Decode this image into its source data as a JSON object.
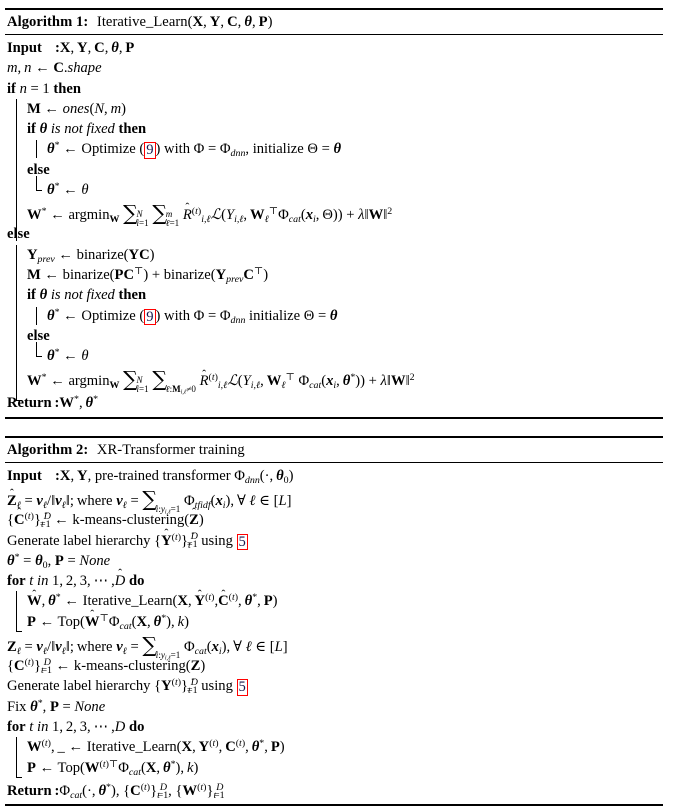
{
  "document": {
    "kind": "algorithm-pseudocode-listing",
    "page_background": "#ffffff",
    "text_color": "#000000",
    "reference_box_color": "#ff0000",
    "reference_link_color": "#1a1a4e"
  },
  "algorithms": [
    {
      "id": "algorithm-1",
      "label": "Algorithm 1:",
      "name": "Iterative_Learn(X, Y, C, θ, P)",
      "title_plain": "Algorithm 1: Iterative_Learn(X, Y, C, θ, P)",
      "input_keyword": "Input",
      "input_separator": ":",
      "input_args": "X, Y, C, θ, P",
      "return_keyword": "Return",
      "return_separator": ":",
      "return_value": "W*, θ*",
      "reference_number": "9",
      "lines": [
        "Input : X, Y, C, θ, P",
        "m, n ← C.shape",
        "if n = 1 then",
        "M ← ones(N, m)",
        "if θ is not fixed then",
        "θ* ← Optimize (9) with Φ = Φ_dnn, initialize Θ = θ",
        "else",
        "θ* ← θ",
        "W* ← argmin_W ∑_{i=1}^{N} ∑_{ℓ=1}^{m} R̂^{(t)}_{i,ℓ} ℒ(Y_{i,ℓ}, W_ℓ^⊤ Φ_cat(x_i, Θ)) + λ‖W‖²",
        "else",
        "Y_prev ← binarize(YC)",
        "M ← binarize(PC⊤) + binarize(Y_prev C⊤)",
        "if θ is not fixed then",
        "θ* ← Optimize (9) with Φ = Φ_dnn initialize Θ = θ",
        "else",
        "θ* ← θ",
        "W* ← argmin_W ∑_{i=1}^{N} ∑_{ℓ:M_{i,ℓ}≠0} R̂^{(t)}_{i,ℓ} ℒ(Y_{i,ℓ}, W_ℓ^⊤ Φ_cat(x_i, θ*)) + λ‖W‖²",
        "Return : W*, θ*"
      ]
    },
    {
      "id": "algorithm-2",
      "label": "Algorithm 2:",
      "name": "XR-Transformer training",
      "title_plain": "Algorithm 2: XR-Transformer training",
      "input_keyword": "Input",
      "input_separator": ":",
      "input_args": "X, Y, pre-trained transformer Φ_dnn(·, θ₀)",
      "return_keyword": "Return",
      "return_separator": ":",
      "return_value": "Φ_cat(·, θ*), {C^(t)}_{t=1}^{D}, {W^(t)}_{t=1}^{D}",
      "reference_number": "5",
      "lines": [
        "Input : X, Y, pre-trained transformer Φ_dnn(·, θ₀)",
        "Ẑ_ℓ = v_ℓ/‖v_ℓ‖; where v_ℓ = ∑_{i:y_{i,ℓ}=1} Φ_tfidf(x_i), ∀ ℓ ∈ [L]",
        "{Ĉ^(t)}_{t=1}^{D̂} ← k-means-clustering(Ẑ)",
        "Generate label hierarchy {Ŷ^(t)}_{t=1}^{D̂} using 5",
        "θ* = θ₀, P = None",
        "for t in 1, 2, 3, ⋯ , D̂ do",
        "Ŵ, θ* ← Iterative_Learn(X, Ŷ^(t), Ĉ^(t), θ*, P)",
        "P ← Top(Ŵ⊤ Φ_cat(X, θ*), k)",
        "Z_ℓ = v_ℓ/‖v_ℓ‖; where v_ℓ = ∑_{i:y_{i,ℓ}=1} Φ_cat(x_i), ∀ ℓ ∈ [L]",
        "{C^(t)}_{t=1}^{D} ← k-means-clustering(Z)",
        "Generate label hierarchy {Y^(t)}_{t=1}^{D̂} using 5",
        "Fix θ*, P = None",
        "for t in 1, 2, 3, ⋯ , D do",
        "W^(t), _ ← Iterative_Learn(X, Y^(t), C^(t), θ*, P)",
        "P ← Top(W^(t)⊤ Φ_cat(X, θ*), k)",
        "Return : Φ_cat(·, θ*), {C^(t)}_{t=1}^{D}, {W^(t)}_{t=1}^{D}"
      ]
    }
  ],
  "keywords": {
    "if": "if",
    "then": "then",
    "else": "else",
    "for": "for",
    "in": "in",
    "do": "do",
    "input": "Input",
    "return": "Return"
  },
  "functions": {
    "iterative_learn": "Iterative_Learn",
    "ones": "ones",
    "binarize": "binarize",
    "optimize": "Optimize",
    "argmin": "argmin",
    "kmeans": "k-means-clustering",
    "top": "Top",
    "none": "None",
    "shape": "C.shape",
    "generate_label_hierarchy": "Generate label hierarchy",
    "using": "using",
    "fix": "Fix",
    "pretrained": "pre-trained transformer",
    "where": "where",
    "is_not_fixed": "is not fixed",
    "initialize": "initialize",
    "with": "with",
    "xr_transformer_training": "XR-Transformer training"
  }
}
